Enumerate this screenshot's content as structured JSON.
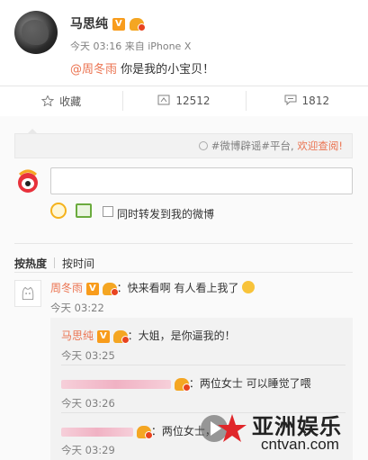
{
  "post": {
    "author": "马思纯",
    "meta": "今天 03:16 来自 iPhone X",
    "mention": "@周冬雨",
    "text": " 你是我的小宝贝！"
  },
  "actions": {
    "favorite": "收藏",
    "forward_count": "12512",
    "comment_count": "1812"
  },
  "notice": {
    "prefix": "#微博辟谣#平台, ",
    "link": "欢迎查阅!"
  },
  "comment_box": {
    "forward_label": "同时转发到我的微博"
  },
  "sort": {
    "hot": "按热度",
    "time": "按时间"
  },
  "comments": [
    {
      "name": "周冬雨",
      "text": "：快来看啊 有人看上我了",
      "time": "今天 03:22"
    }
  ],
  "replies": [
    {
      "name": "马思纯",
      "text": "：大姐，是你逼我的！",
      "time": "今天 03:25"
    },
    {
      "text": "：两位女士 可以睡觉了喂",
      "time": "今天 03:26"
    },
    {
      "text": "：两位女士，",
      "time": "今天 03:29"
    }
  ],
  "badges": {
    "v": "V"
  },
  "watermark": {
    "cn": "亚洲娱乐",
    "url": "cntvan.com"
  },
  "colors": {
    "accent": "#eb7350",
    "vip": "#f89c1c"
  }
}
